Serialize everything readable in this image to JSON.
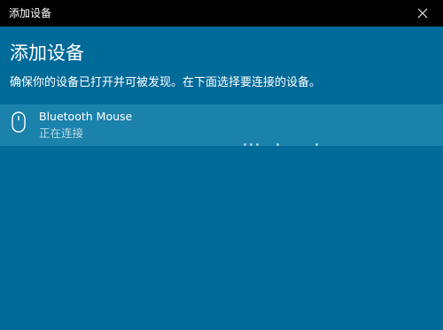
{
  "window": {
    "title": "添加设备",
    "close_icon": "close-icon"
  },
  "main": {
    "heading": "添加设备",
    "instruction": "确保你的设备已打开并可被发现。在下面选择要连接的设备。"
  },
  "devices": [
    {
      "name": "Bluetooth Mouse",
      "status": "正在连接",
      "icon": "mouse-icon"
    }
  ],
  "progress": {
    "icon": "loading-dots-icon"
  },
  "colors": {
    "background": "#006a99",
    "titlebar": "#000000",
    "selected_row": "#1a82ab",
    "status_text": "#bcdbe8"
  }
}
